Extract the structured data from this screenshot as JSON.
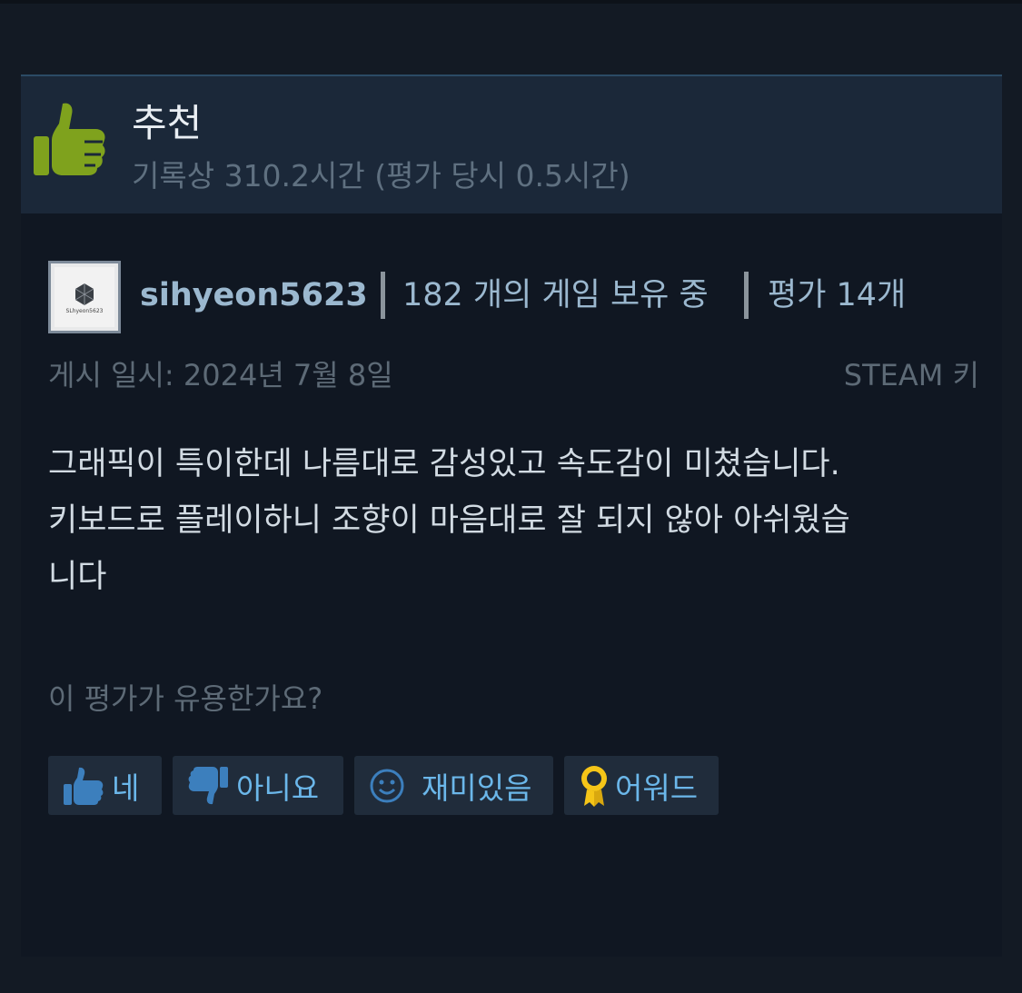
{
  "review": {
    "recommendation": "추천",
    "hours": "기록상 310.2시간 (평가 당시 0.5시간)",
    "author": {
      "avatar_text": "SLhyeon5623",
      "username": "sihyeon5623",
      "games_owned": "182 개의 게임 보유 중",
      "reviews": "평가 14개"
    },
    "posted": "게시 일시: 2024년 7월 8일",
    "source": "STEAM 키",
    "body_lines": [
      "그래픽이 특이한데 나름대로 감성있고 속도감이 미쳤습니다.",
      "키보드로 플레이하니 조향이 마음대로 잘 되지 않아 아쉬웠습",
      "니다"
    ],
    "helpful_question": "이 평가가 유용한가요?",
    "buttons": {
      "yes": "네",
      "no": "아니요",
      "funny": "재미있음",
      "award": "어워드"
    }
  },
  "colors": {
    "thumb_green": "#7fa21d",
    "link_blue": "#6bb7ea",
    "award_gold": "#f5c518"
  },
  "icons": [
    "thumbs-up-icon",
    "thumbs-down-icon",
    "smiley-icon",
    "award-ribbon-icon"
  ]
}
